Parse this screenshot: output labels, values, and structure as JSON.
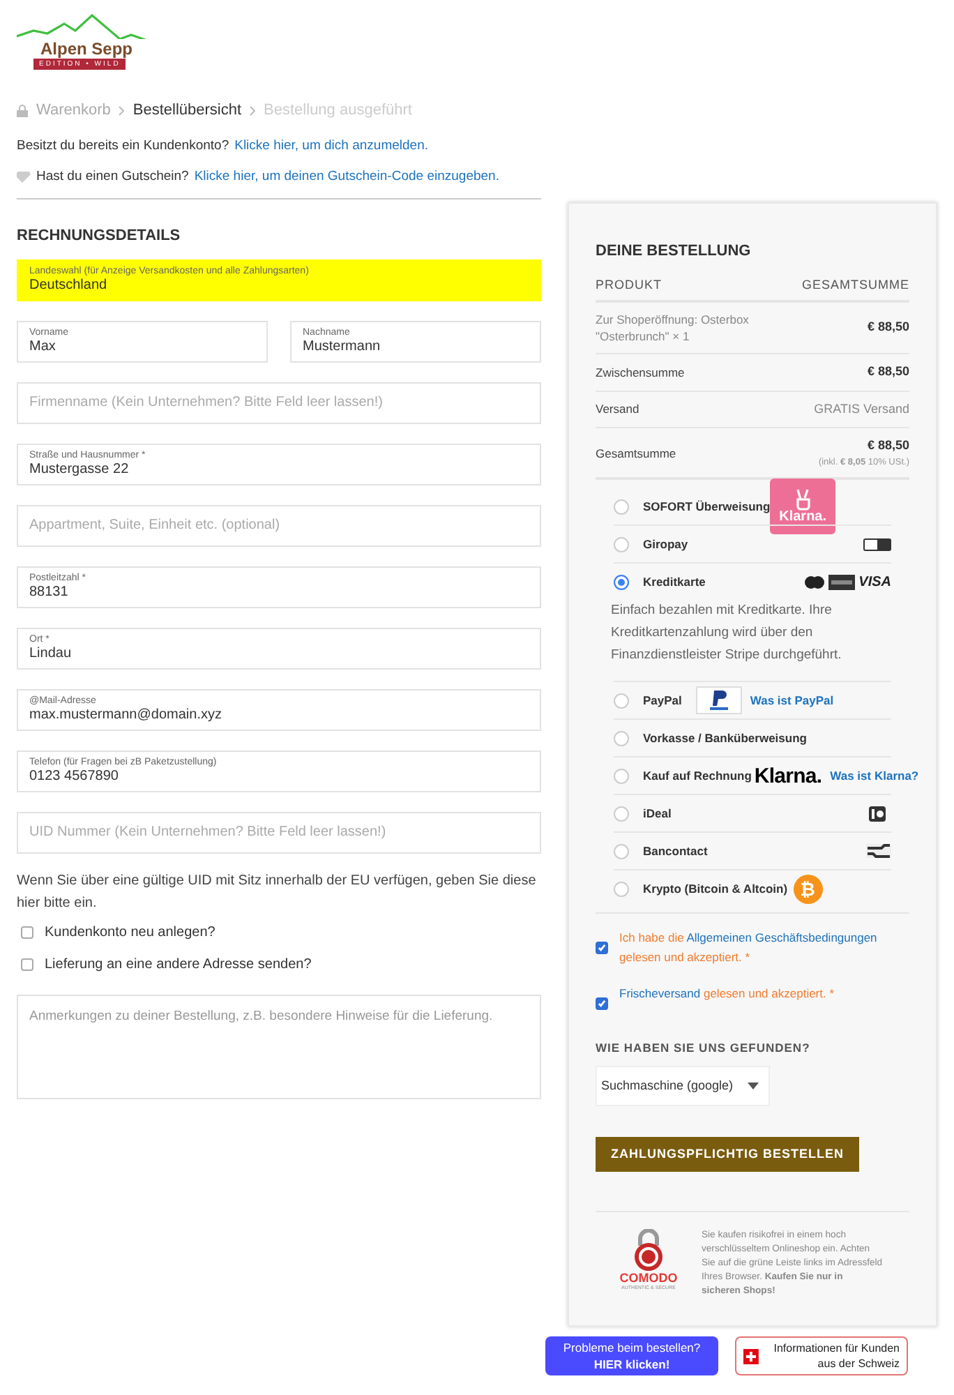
{
  "logo": {
    "name": "Alpen Sepp",
    "tagline": "EDITION • WILD"
  },
  "breadcrumb": [
    {
      "label": "Warenkorb",
      "kind": "past"
    },
    {
      "label": "Bestellübersicht",
      "kind": "current"
    },
    {
      "label": "Bestellung ausgeführt",
      "kind": "future"
    }
  ],
  "notices": [
    {
      "kind": "login",
      "text": "Besitzt du bereits ein Kundenkonto?",
      "link": "Klicke hier, um dich anzumelden."
    },
    {
      "kind": "coupon",
      "text": "Hast du einen Gutschein?",
      "link": "Klicke hier, um deinen Gutschein-Code einzugeben."
    }
  ],
  "billing": {
    "title": "RECHNUNGSDETAILS",
    "rows": [
      [
        {
          "label": "Landeswahl (für Anzeige Versandkosten und alle Zahlungsarten)",
          "value": "Deutschland",
          "highlighted": true
        }
      ],
      [
        {
          "label": "Vorname",
          "value": "Max",
          "highlighted": false
        },
        {
          "label": "Nachname",
          "value": "Mustermann",
          "highlighted": false
        }
      ],
      [
        {
          "placeholder": "Firmenname (Kein Unternehmen? Bitte Feld leer lassen!)",
          "highlighted": false
        }
      ],
      [
        {
          "label": "Straße und Hausnummer *",
          "value": "Mustergasse 22",
          "highlighted": false
        }
      ],
      [
        {
          "placeholder": "Appartment, Suite, Einheit etc. (optional)",
          "highlighted": false
        }
      ],
      [
        {
          "label": "Postleitzahl *",
          "value": "88131",
          "highlighted": false
        }
      ],
      [
        {
          "label": "Ort *",
          "value": "Lindau",
          "highlighted": false
        }
      ],
      [
        {
          "label": "@Mail-Adresse",
          "value": "max.mustermann@domain.xyz",
          "highlighted": false
        }
      ],
      [
        {
          "label": "Telefon (für Fragen bei zB Paketzustellung)",
          "value": "0123 4567890",
          "highlighted": false
        }
      ],
      [
        {
          "placeholder": "UID Nummer (Kein Unternehmen? Bitte Feld leer lassen!)",
          "highlighted": false
        }
      ]
    ],
    "uid_note": "Wenn Sie über eine gültige UID mit Sitz innerhalb der EU verfügen, geben Sie diese hier bitte ein.",
    "checkboxes": [
      {
        "label": "Kundenkonto neu anlegen?",
        "checked": false
      },
      {
        "label": "Lieferung an eine andere Adresse senden?",
        "checked": false
      }
    ],
    "notes_placeholder": "Anmerkungen zu deiner Bestellung, z.B. besondere Hinweise für die Lieferung."
  },
  "order": {
    "title": "DEINE BESTELLUNG",
    "columns": [
      "PRODUKT",
      "GESAMTSUMME"
    ],
    "rows": [
      {
        "kind": "item",
        "label": "Zur Shoperöffnung: Osterbox \"Osterbrunch\"  × 1",
        "value": "€ 88,50"
      },
      {
        "kind": "line",
        "label": "Zwischensumme",
        "value": "€ 88,50"
      },
      {
        "kind": "note",
        "label": "Versand",
        "value": "GRATIS Versand"
      },
      {
        "kind": "total",
        "label": "Gesamtsumme",
        "value": "€ 88,50",
        "tax": "(inkl. **€ 8,05** 10% USt.)"
      }
    ]
  },
  "payments": [
    {
      "label": "SOFORT Überweisung",
      "selected": false,
      "kind": "klarna_badge",
      "logo_text": "Klarna."
    },
    {
      "label": "Giropay",
      "selected": false,
      "kind": "giropay"
    },
    {
      "label": "Kreditkarte",
      "selected": true,
      "kind": "cards",
      "logo_text": "VISA",
      "description": "Einfach bezahlen mit Kreditkarte. Ihre Kreditkartenzahlung wird über den Finanzdienstleister Stripe durchgeführt."
    },
    {
      "label": "PayPal",
      "selected": false,
      "kind": "paypal",
      "link": "Was ist PayPal"
    },
    {
      "label": "Vorkasse / Banküberweisung",
      "selected": false
    },
    {
      "label": "Kauf auf Rechnung",
      "selected": false,
      "kind": "klarna_wordmark",
      "logo_text": "Klarna.",
      "link": "Was ist Klarna?"
    },
    {
      "label": "iDeal",
      "selected": false,
      "kind": "ideal"
    },
    {
      "label": "Bancontact",
      "selected": false,
      "kind": "bancontact"
    },
    {
      "label": "Krypto (Bitcoin & Altcoin)",
      "selected": false,
      "kind": "bitcoin",
      "logo_text": "₿"
    }
  ],
  "terms": [
    {
      "checked": true,
      "before": "Ich habe die ",
      "link": "Allgemeinen Geschäftsbedingungen",
      "after": " gelesen und akzeptiert. *"
    },
    {
      "checked": true,
      "link": "Frischeversand",
      "after": " gelesen und akzeptiert. *"
    }
  ],
  "found": {
    "label": "WIE HABEN SIE UNS GEFUNDEN?",
    "value": "Suchmaschine (google)"
  },
  "submit": "ZAHLUNGSPFLICHTIG BESTELLEN",
  "security": {
    "brand": "COMODO",
    "sub": "AUTHENTIC & SECURE",
    "text": "Sie kaufen risikofrei in einem hoch verschlüsseltem Onlineshop ein. Achten Sie auf die grüne Leiste links im Adressfeld Ihres Browser. **Kaufen Sie nur in sicheren Shops!**"
  },
  "help": {
    "line1": "Probleme beim bestellen?",
    "line2": "HIER klicken!"
  },
  "swiss": {
    "text": "Informationen für Kunden aus der Schweiz"
  }
}
